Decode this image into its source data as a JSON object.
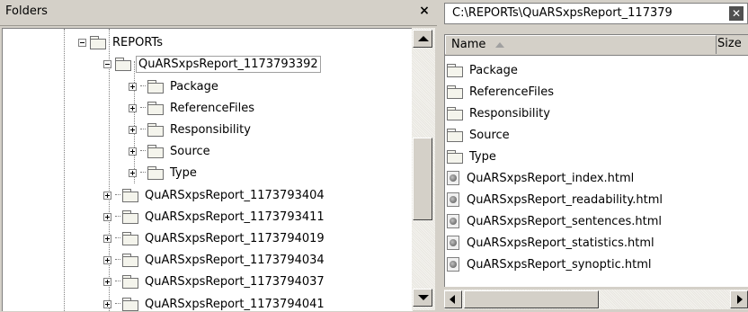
{
  "folders_pane": {
    "title": "Folders",
    "close_glyph": "×",
    "tree": [
      {
        "label": "REPORTs",
        "expander": "minus",
        "selected": false
      },
      {
        "label": "QuARSxpsReport_1173793392",
        "expander": "minus",
        "selected": true
      },
      {
        "label": "Package",
        "expander": "plus",
        "selected": false
      },
      {
        "label": "ReferenceFiles",
        "expander": "plus",
        "selected": false
      },
      {
        "label": "Responsibility",
        "expander": "plus",
        "selected": false
      },
      {
        "label": "Source",
        "expander": "plus",
        "selected": false
      },
      {
        "label": "Type",
        "expander": "plus",
        "selected": false
      },
      {
        "label": "QuARSxpsReport_1173793404",
        "expander": "plus",
        "selected": false
      },
      {
        "label": "QuARSxpsReport_1173793411",
        "expander": "plus",
        "selected": false
      },
      {
        "label": "QuARSxpsReport_1173794019",
        "expander": "plus",
        "selected": false
      },
      {
        "label": "QuARSxpsReport_1173794034",
        "expander": "plus",
        "selected": false
      },
      {
        "label": "QuARSxpsReport_1173794037",
        "expander": "plus",
        "selected": false
      },
      {
        "label": "QuARSxpsReport_1173794041",
        "expander": "plus",
        "selected": false
      }
    ]
  },
  "files_pane": {
    "path": "C:\\REPORTs\\QuARSxpsReport_117379",
    "close_glyph": "✕",
    "columns": {
      "name": "Name",
      "size": "Size"
    },
    "items": [
      {
        "name": "Package",
        "icon": "folder-icon"
      },
      {
        "name": "ReferenceFiles",
        "icon": "folder-icon"
      },
      {
        "name": "Responsibility",
        "icon": "folder-icon"
      },
      {
        "name": "Source",
        "icon": "folder-icon"
      },
      {
        "name": "Type",
        "icon": "folder-icon"
      },
      {
        "name": "QuARSxpsReport_index.html",
        "icon": "html-file-icon"
      },
      {
        "name": "QuARSxpsReport_readability.html",
        "icon": "html-file-icon"
      },
      {
        "name": "QuARSxpsReport_sentences.html",
        "icon": "html-file-icon"
      },
      {
        "name": "QuARSxpsReport_statistics.html",
        "icon": "html-file-icon"
      },
      {
        "name": "QuARSxpsReport_synoptic.html",
        "icon": "html-file-icon"
      }
    ]
  }
}
